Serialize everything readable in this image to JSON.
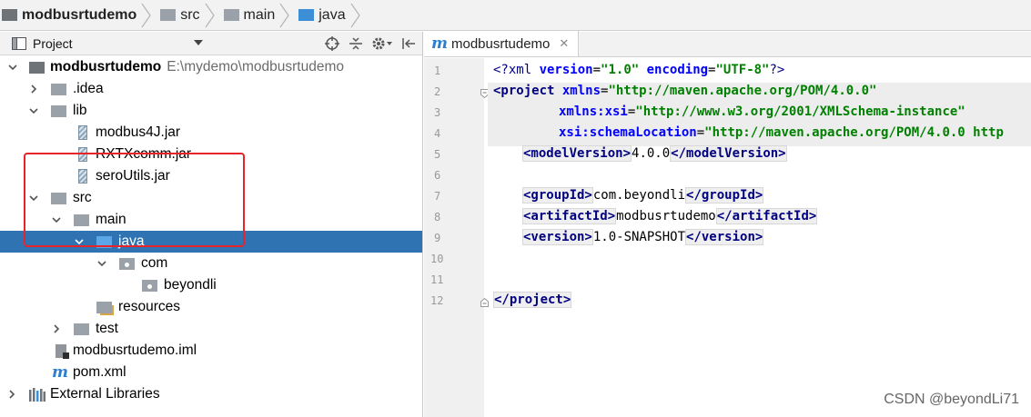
{
  "breadcrumb": [
    {
      "label": "modbusrtudemo",
      "icon": "module-folder-icon"
    },
    {
      "label": "src",
      "icon": "folder-icon"
    },
    {
      "label": "main",
      "icon": "folder-icon"
    },
    {
      "label": "java",
      "icon": "source-folder-icon"
    }
  ],
  "project_panel": {
    "title": "Project",
    "tools": [
      "locate-icon",
      "collapse-all-icon",
      "settings-icon",
      "hide-icon"
    ]
  },
  "tree": {
    "root_name": "modbusrtudemo",
    "root_path": "E:\\mydemo\\modbusrtudemo",
    "idea": ".idea",
    "lib": "lib",
    "jar1": "modbus4J.jar",
    "jar2": "RXTXcomm.jar",
    "jar3": "seroUtils.jar",
    "src": "src",
    "main": "main",
    "java": "java",
    "com": "com",
    "beyondli": "beyondli",
    "resources": "resources",
    "test": "test",
    "iml": "modbusrtudemo.iml",
    "pom": "pom.xml",
    "ext": "External Libraries"
  },
  "editor": {
    "tab_label": "modbusrtudemo",
    "tab_icon": "maven-icon",
    "line_numbers": [
      "1",
      "2",
      "3",
      "4",
      "5",
      "6",
      "7",
      "8",
      "9",
      "10",
      "11",
      "12"
    ],
    "lines": {
      "l1_open": "<?xml ",
      "l1_a1": "version",
      "l1_eq1": "=",
      "l1_v1": "\"1.0\"",
      "l1_a2": " encoding",
      "l1_eq2": "=",
      "l1_v2": "\"UTF-8\"",
      "l1_close": "?>",
      "l2_tag": "<project ",
      "l2_attr": "xmlns",
      "l2_eq": "=",
      "l2_val": "\"http://maven.apache.org/POM/4.0.0\"",
      "l3_attr": "xmlns:xsi",
      "l3_eq": "=",
      "l3_val": "\"http://www.w3.org/2001/XMLSchema-instance\"",
      "l4_attr": "xsi:schemaLocation",
      "l4_eq": "=",
      "l4_val": "\"http://maven.apache.org/POM/4.0.0 http",
      "l5_open": "<modelVersion>",
      "l5_text": "4.0.0",
      "l5_close": "</modelVersion>",
      "l7_open": "<groupId>",
      "l7_text": "com.beyondli",
      "l7_close": "</groupId>",
      "l8_open": "<artifactId>",
      "l8_text": "modbusrtudemo",
      "l8_close": "</artifactId>",
      "l9_open": "<version>",
      "l9_text": "1.0-SNAPSHOT",
      "l9_close": "</version>",
      "l12_close": "</project>"
    }
  },
  "watermark": "CSDN @beyondLi71",
  "colors": {
    "selection": "#2f73b3",
    "highlight_box": "#e8242b",
    "xml_tag": "#000080",
    "xml_value": "#008000"
  }
}
